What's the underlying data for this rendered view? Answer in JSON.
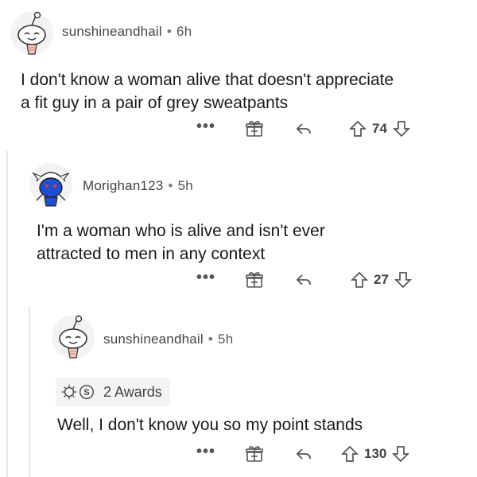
{
  "comments": [
    {
      "username": "sunshineandhail",
      "separator": "•",
      "time": "6h",
      "lines": [
        "I don't know a woman alive that doesn't appreciate",
        "a fit guy in a pair of grey sweatpants"
      ],
      "more": "•••",
      "votes": "74"
    },
    {
      "username": "Morighan123",
      "separator": "•",
      "time": "5h",
      "lines": [
        "I'm a woman who is alive and isn't ever",
        "attracted to men in any context"
      ],
      "more": "•••",
      "votes": "27"
    },
    {
      "username": "sunshineandhail",
      "separator": "•",
      "time": "5h",
      "awards_label": "2 Awards",
      "lines": [
        "Well, I don't know you so my point stands"
      ],
      "more": "•••",
      "votes": "130"
    }
  ],
  "icons": {
    "more": "more-options-icon",
    "award": "gift-award-icon",
    "reply": "reply-arrow-icon",
    "upvote": "upvote-arrow-icon",
    "downvote": "downvote-arrow-icon"
  },
  "colors": {
    "text": "#1a1a1b",
    "meta": "#444444",
    "thread_line": "#e6e6e6",
    "awards_bg": "#f4f4f4",
    "avatar_blue": "#1f4fd1"
  }
}
